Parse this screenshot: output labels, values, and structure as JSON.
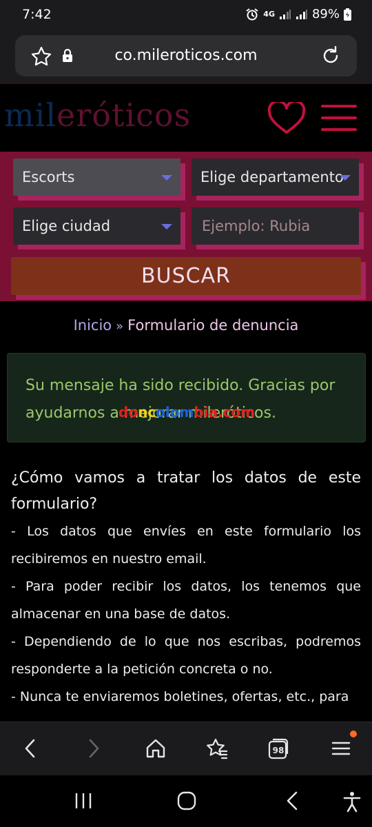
{
  "status": {
    "time": "7:42",
    "battery": "89%",
    "network": "4G"
  },
  "browser": {
    "url": "co.mileroticos.com"
  },
  "site": {
    "logo_part1": "mil",
    "logo_part2": "eróticos",
    "accent_color": "#c2103d"
  },
  "search": {
    "category_selected": "Escorts",
    "department_selected": "Elige departamento",
    "city_selected": "Elige ciudad",
    "keyword_placeholder": "Ejemplo: Rubia",
    "submit_label": "BUSCAR"
  },
  "breadcrumb": {
    "home": "Inicio",
    "separator": "»",
    "current": "Formulario de denuncia"
  },
  "notice": {
    "message": "Su mensaje ha sido recibido. Gracias por ayudarnos a mejorar mileróticos.",
    "color": "#98c96c"
  },
  "watermark": {
    "p1": "do",
    "p2": "nc",
    "p3": "olom",
    "p4": "bia.com"
  },
  "content": {
    "heading": "¿Cómo vamos a tratar los datos de este formulario?",
    "items": [
      "- Los datos que envíes en este formulario los recibiremos en nuestro email.",
      "- Para poder recibir los datos, los tenemos que almacenar en una base de datos.",
      "- Dependiendo de lo que nos escribas, podremos responderte a la petición concreta o no.",
      "- Nunca te enviaremos boletines, ofertas, etc., para"
    ]
  },
  "bottom_nav": {
    "icons": [
      "back-icon",
      "forward-icon",
      "home-icon",
      "bookmarks-icon",
      "tabs-icon",
      "menu-icon"
    ],
    "tabs_count": "98"
  },
  "system_nav": {
    "icons": [
      "recents-icon",
      "home-circle-icon",
      "back-chevron-icon",
      "accessibility-icon"
    ]
  }
}
